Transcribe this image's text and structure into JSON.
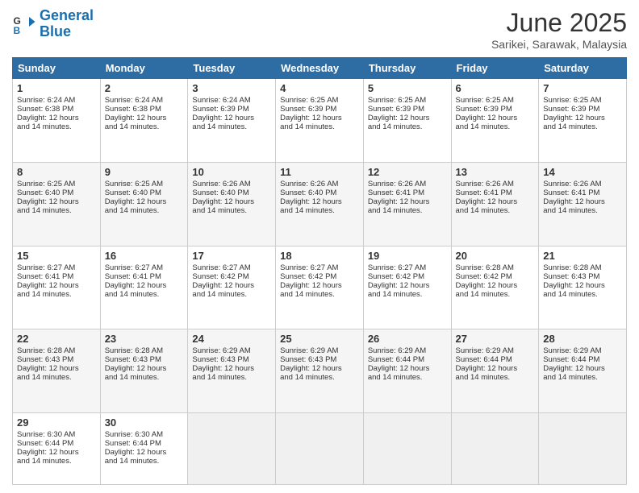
{
  "logo": {
    "line1": "General",
    "line2": "Blue"
  },
  "title": "June 2025",
  "location": "Sarikei, Sarawak, Malaysia",
  "days_of_week": [
    "Sunday",
    "Monday",
    "Tuesday",
    "Wednesday",
    "Thursday",
    "Friday",
    "Saturday"
  ],
  "weeks": [
    [
      {
        "day": 1,
        "sunrise": "6:24 AM",
        "sunset": "6:38 PM",
        "daylight": "12 hours and 14 minutes."
      },
      {
        "day": 2,
        "sunrise": "6:24 AM",
        "sunset": "6:38 PM",
        "daylight": "12 hours and 14 minutes."
      },
      {
        "day": 3,
        "sunrise": "6:24 AM",
        "sunset": "6:39 PM",
        "daylight": "12 hours and 14 minutes."
      },
      {
        "day": 4,
        "sunrise": "6:25 AM",
        "sunset": "6:39 PM",
        "daylight": "12 hours and 14 minutes."
      },
      {
        "day": 5,
        "sunrise": "6:25 AM",
        "sunset": "6:39 PM",
        "daylight": "12 hours and 14 minutes."
      },
      {
        "day": 6,
        "sunrise": "6:25 AM",
        "sunset": "6:39 PM",
        "daylight": "12 hours and 14 minutes."
      },
      {
        "day": 7,
        "sunrise": "6:25 AM",
        "sunset": "6:39 PM",
        "daylight": "12 hours and 14 minutes."
      }
    ],
    [
      {
        "day": 8,
        "sunrise": "6:25 AM",
        "sunset": "6:40 PM",
        "daylight": "12 hours and 14 minutes."
      },
      {
        "day": 9,
        "sunrise": "6:25 AM",
        "sunset": "6:40 PM",
        "daylight": "12 hours and 14 minutes."
      },
      {
        "day": 10,
        "sunrise": "6:26 AM",
        "sunset": "6:40 PM",
        "daylight": "12 hours and 14 minutes."
      },
      {
        "day": 11,
        "sunrise": "6:26 AM",
        "sunset": "6:40 PM",
        "daylight": "12 hours and 14 minutes."
      },
      {
        "day": 12,
        "sunrise": "6:26 AM",
        "sunset": "6:41 PM",
        "daylight": "12 hours and 14 minutes."
      },
      {
        "day": 13,
        "sunrise": "6:26 AM",
        "sunset": "6:41 PM",
        "daylight": "12 hours and 14 minutes."
      },
      {
        "day": 14,
        "sunrise": "6:26 AM",
        "sunset": "6:41 PM",
        "daylight": "12 hours and 14 minutes."
      }
    ],
    [
      {
        "day": 15,
        "sunrise": "6:27 AM",
        "sunset": "6:41 PM",
        "daylight": "12 hours and 14 minutes."
      },
      {
        "day": 16,
        "sunrise": "6:27 AM",
        "sunset": "6:41 PM",
        "daylight": "12 hours and 14 minutes."
      },
      {
        "day": 17,
        "sunrise": "6:27 AM",
        "sunset": "6:42 PM",
        "daylight": "12 hours and 14 minutes."
      },
      {
        "day": 18,
        "sunrise": "6:27 AM",
        "sunset": "6:42 PM",
        "daylight": "12 hours and 14 minutes."
      },
      {
        "day": 19,
        "sunrise": "6:27 AM",
        "sunset": "6:42 PM",
        "daylight": "12 hours and 14 minutes."
      },
      {
        "day": 20,
        "sunrise": "6:28 AM",
        "sunset": "6:42 PM",
        "daylight": "12 hours and 14 minutes."
      },
      {
        "day": 21,
        "sunrise": "6:28 AM",
        "sunset": "6:43 PM",
        "daylight": "12 hours and 14 minutes."
      }
    ],
    [
      {
        "day": 22,
        "sunrise": "6:28 AM",
        "sunset": "6:43 PM",
        "daylight": "12 hours and 14 minutes."
      },
      {
        "day": 23,
        "sunrise": "6:28 AM",
        "sunset": "6:43 PM",
        "daylight": "12 hours and 14 minutes."
      },
      {
        "day": 24,
        "sunrise": "6:29 AM",
        "sunset": "6:43 PM",
        "daylight": "12 hours and 14 minutes."
      },
      {
        "day": 25,
        "sunrise": "6:29 AM",
        "sunset": "6:43 PM",
        "daylight": "12 hours and 14 minutes."
      },
      {
        "day": 26,
        "sunrise": "6:29 AM",
        "sunset": "6:44 PM",
        "daylight": "12 hours and 14 minutes."
      },
      {
        "day": 27,
        "sunrise": "6:29 AM",
        "sunset": "6:44 PM",
        "daylight": "12 hours and 14 minutes."
      },
      {
        "day": 28,
        "sunrise": "6:29 AM",
        "sunset": "6:44 PM",
        "daylight": "12 hours and 14 minutes."
      }
    ],
    [
      {
        "day": 29,
        "sunrise": "6:30 AM",
        "sunset": "6:44 PM",
        "daylight": "12 hours and 14 minutes."
      },
      {
        "day": 30,
        "sunrise": "6:30 AM",
        "sunset": "6:44 PM",
        "daylight": "12 hours and 14 minutes."
      },
      null,
      null,
      null,
      null,
      null
    ]
  ],
  "labels": {
    "sunrise": "Sunrise:",
    "sunset": "Sunset:",
    "daylight": "Daylight:"
  }
}
